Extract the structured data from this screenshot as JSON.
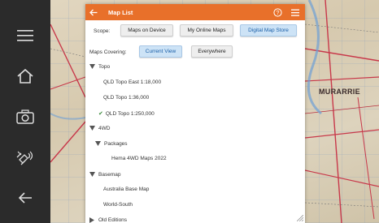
{
  "panel": {
    "title": "Map List",
    "scope_label": "Scope:",
    "scope_options": [
      "Maps on Device",
      "My Online Maps",
      "Digital Map Store"
    ],
    "covering_label": "Maps Covering:",
    "covering_options": [
      "Current View",
      "Everywhere"
    ]
  },
  "tree": {
    "topo": "Topo",
    "topo_items": [
      "QLD Topo East 1:18,000",
      "QLD Topo 1:36,000",
      "QLD Topo 1:250,000"
    ],
    "fourwd": "4WD",
    "packages": "Packages",
    "package_items": [
      "Hema 4WD Maps 2022"
    ],
    "basemap": "Basemap",
    "basemap_items": [
      "Australia Base Map",
      "World-South"
    ],
    "old": "Old Editions"
  },
  "map_labels": {
    "murarrie": "MURARRIE"
  },
  "colors": {
    "accent": "#e8702a",
    "selected": "#cde3f6",
    "sidebar": "#2b2b2b"
  }
}
